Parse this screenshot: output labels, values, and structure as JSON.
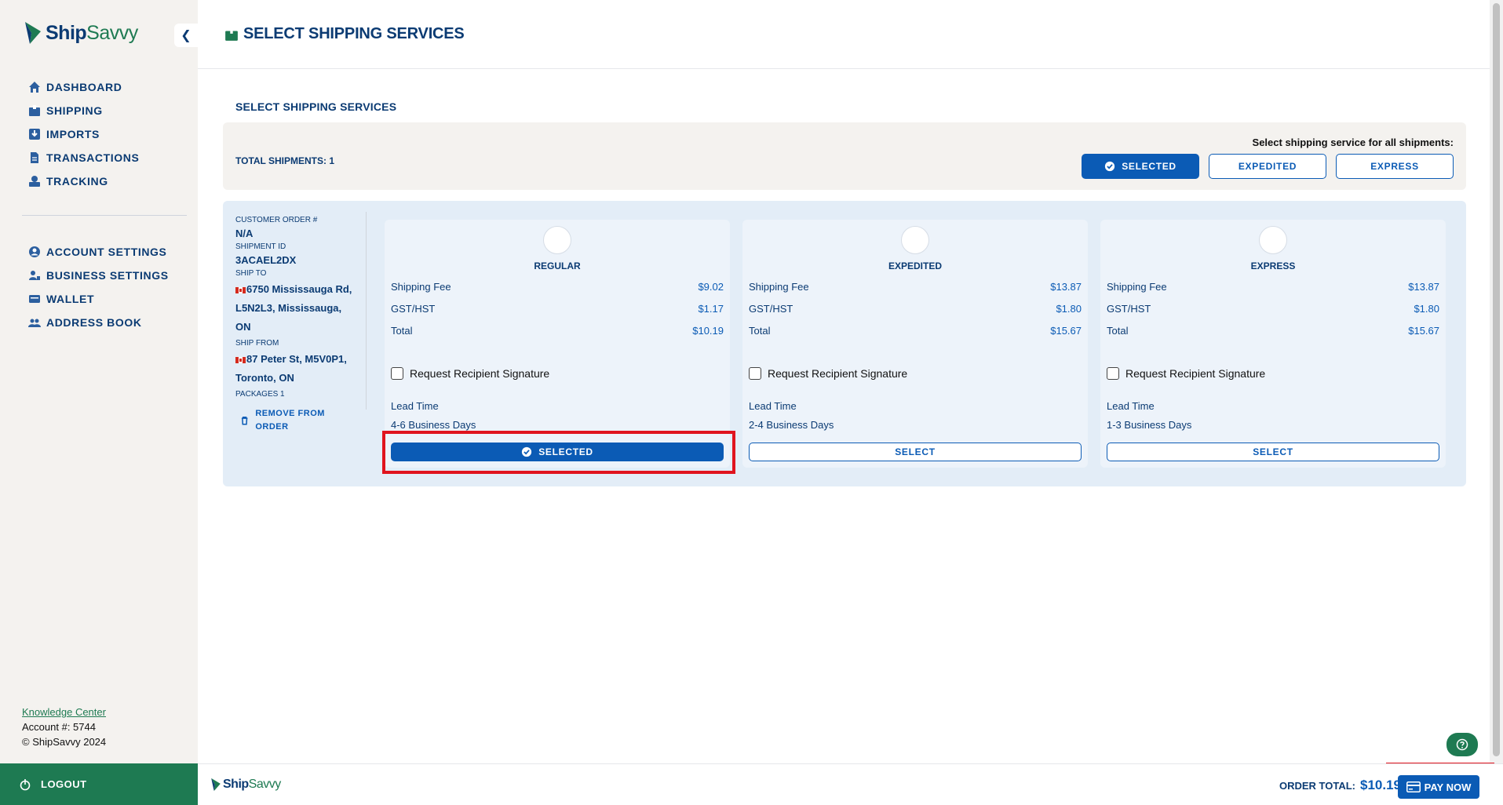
{
  "brand": {
    "name_part1": "Ship",
    "name_part2": "Savvy"
  },
  "sidebar": {
    "main_items": [
      {
        "label": "DASHBOARD",
        "icon": "home-icon"
      },
      {
        "label": "SHIPPING",
        "icon": "box-icon"
      },
      {
        "label": "IMPORTS",
        "icon": "import-icon"
      },
      {
        "label": "TRANSACTIONS",
        "icon": "document-icon"
      },
      {
        "label": "TRACKING",
        "icon": "tracking-icon"
      }
    ],
    "settings_items": [
      {
        "label": "ACCOUNT SETTINGS",
        "icon": "user-icon"
      },
      {
        "label": "BUSINESS SETTINGS",
        "icon": "business-icon"
      },
      {
        "label": "WALLET",
        "icon": "wallet-icon"
      },
      {
        "label": "ADDRESS BOOK",
        "icon": "address-book-icon"
      }
    ],
    "knowledge_center": "Knowledge Center",
    "account": "Account #: 5744",
    "copyright": "© ShipSavvy 2024",
    "logout": "LOGOUT"
  },
  "header": {
    "title": "SELECT SHIPPING SERVICES"
  },
  "main": {
    "section_title": "SELECT SHIPPING SERVICES",
    "total_shipments": "TOTAL SHIPMENTS: 1",
    "all_label": "Select shipping service for all shipments:",
    "all_buttons": {
      "selected": "SELECTED",
      "expedited": "EXPEDITED",
      "express": "EXPRESS"
    }
  },
  "order": {
    "customer_order_label": "CUSTOMER ORDER #",
    "customer_order_value": "N/A",
    "shipment_id_label": "SHIPMENT ID",
    "shipment_id_value": "3ACAEL2DX",
    "ship_to_label": "SHIP TO",
    "ship_to_line1": "6750 Mississauga Rd,",
    "ship_to_line2": "L5N2L3, Mississauga, ON",
    "ship_from_label": "SHIP FROM",
    "ship_from_line1": "87 Peter St, M5V0P1,",
    "ship_from_line2": "Toronto, ON",
    "packages": "PACKAGES 1",
    "remove": "REMOVE FROM ORDER"
  },
  "services": [
    {
      "name": "REGULAR",
      "fee_label": "Shipping Fee",
      "fee": "$9.02",
      "tax_label": "GST/HST",
      "tax": "$1.17",
      "total_label": "Total",
      "total": "$10.19",
      "signature": "Request Recipient Signature",
      "lead_label": "Lead Time",
      "lead": "4-6 Business Days",
      "button": "SELECTED"
    },
    {
      "name": "EXPEDITED",
      "fee_label": "Shipping Fee",
      "fee": "$13.87",
      "tax_label": "GST/HST",
      "tax": "$1.80",
      "total_label": "Total",
      "total": "$15.67",
      "signature": "Request Recipient Signature",
      "lead_label": "Lead Time",
      "lead": "2-4 Business Days",
      "button": "SELECT"
    },
    {
      "name": "EXPRESS",
      "fee_label": "Shipping Fee",
      "fee": "$13.87",
      "tax_label": "GST/HST",
      "tax": "$1.80",
      "total_label": "Total",
      "total": "$15.67",
      "signature": "Request Recipient Signature",
      "lead_label": "Lead Time",
      "lead": "1-3 Business Days",
      "button": "SELECT"
    }
  ],
  "footer": {
    "order_total_label": "ORDER TOTAL:",
    "order_total_value": "$10.19",
    "pay_now": "PAY NOW"
  },
  "colors": {
    "primary": "#0b5bb5",
    "navy": "#0b3b73",
    "green": "#1e7a52",
    "highlight": "#e0141e"
  }
}
